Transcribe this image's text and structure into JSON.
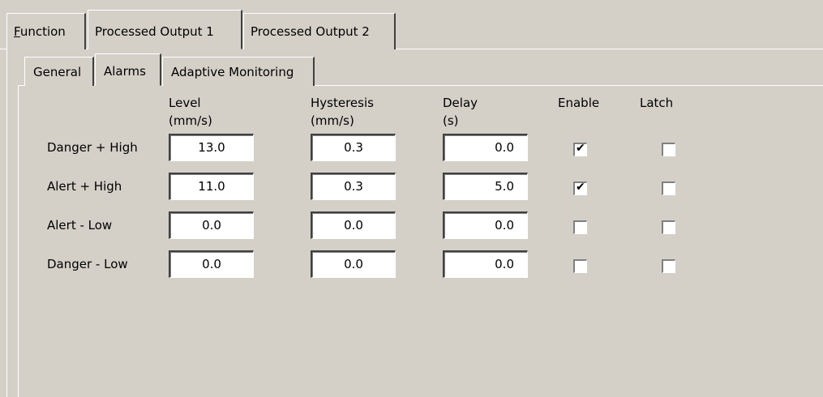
{
  "outer_tabs": [
    {
      "label": "Function",
      "accel": "F",
      "rest": "unction"
    },
    {
      "label": "Processed Output 1"
    },
    {
      "label": "Processed Output 2"
    }
  ],
  "inner_tabs": [
    {
      "label": "General"
    },
    {
      "label": "Alarms"
    },
    {
      "label": "Adaptive Monitoring"
    }
  ],
  "columns": {
    "level": {
      "line1": "Level",
      "line2": "(mm/s)"
    },
    "hysteresis": {
      "line1": "Hysteresis",
      "line2": "(mm/s)"
    },
    "delay": {
      "line1": "Delay",
      "line2": "(s)"
    },
    "enable": "Enable",
    "latch": "Latch"
  },
  "rows": [
    {
      "label": "Danger + High",
      "level": "13.0",
      "hysteresis": "0.3",
      "delay": "0.0",
      "enable": true,
      "latch": false
    },
    {
      "label": "Alert + High",
      "level": "11.0",
      "hysteresis": "0.3",
      "delay": "5.0",
      "enable": true,
      "latch": false
    },
    {
      "label": "Alert - Low",
      "level": "0.0",
      "hysteresis": "0.0",
      "delay": "0.0",
      "enable": false,
      "latch": false
    },
    {
      "label": "Danger - Low",
      "level": "0.0",
      "hysteresis": "0.0",
      "delay": "0.0",
      "enable": false,
      "latch": false
    }
  ],
  "check_glyph": "✔",
  "colors": {
    "face": "#d4d0c8",
    "highlight": "#ffffff",
    "shadow": "#808080",
    "dark_shadow": "#404040"
  }
}
